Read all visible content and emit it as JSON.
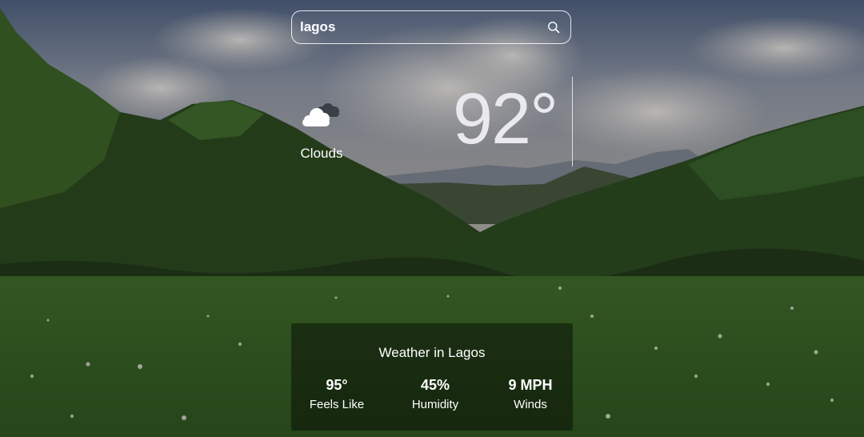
{
  "search": {
    "value": "lagos",
    "icon": "search-icon"
  },
  "current": {
    "icon": "clouds-icon",
    "condition": "Clouds",
    "temperature": "92°"
  },
  "details": {
    "title": "Weather in Lagos",
    "stats": [
      {
        "value": "95°",
        "label": "Feels Like"
      },
      {
        "value": "45%",
        "label": "Humidity"
      },
      {
        "value": "9 MPH",
        "label": "Winds"
      }
    ]
  },
  "colors": {
    "text": "#ffffff",
    "temperature": "#e9e9ee",
    "panel_bg": "rgba(0,0,0,0.42)"
  }
}
